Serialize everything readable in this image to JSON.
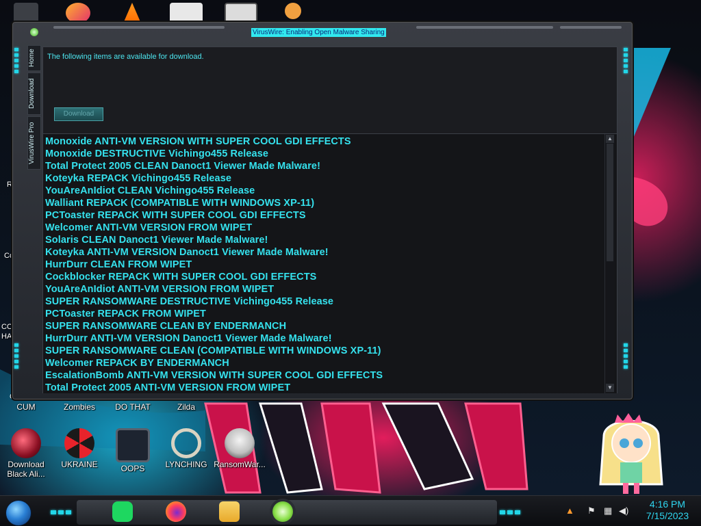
{
  "window": {
    "title": "VirusWire: Enabling Open Malware Sharing",
    "tabs": [
      "Home",
      "Download",
      "VirusWire Pro"
    ],
    "intro_text": "The following items are available for download.",
    "download_button": "Download",
    "items": [
      "Monoxide ANTI-VM VERSION WITH SUPER COOL GDI EFFECTS",
      "Monoxide DESTRUCTIVE Vichingo455 Release",
      "Total Protect 2005 CLEAN Danoct1 Viewer Made Malware!",
      "Koteyka REPACK Vichingo455 Release",
      "YouAreAnIdiot CLEAN Vichingo455 Release",
      "Walliant REPACK (COMPATIBLE WITH WINDOWS XP-11)",
      "PCToaster REPACK WITH SUPER COOL GDI EFFECTS",
      "Welcomer ANTI-VM VERSION FROM WIPET",
      "Solaris CLEAN Danoct1 Viewer Made Malware!",
      "Koteyka ANTI-VM VERSION Danoct1 Viewer Made Malware!",
      "HurrDurr CLEAN FROM WIPET",
      "Cockblocker REPACK WITH SUPER COOL GDI EFFECTS",
      "YouAreAnIdiot ANTI-VM VERSION FROM WIPET",
      "SUPER RANSOMWARE DESTRUCTIVE Vichingo455 Release",
      "PCToaster REPACK FROM WIPET",
      "SUPER RANSOMWARE CLEAN BY ENDERMANCH",
      "HurrDurr ANTI-VM VERSION Danoct1 Viewer Made Malware!",
      "SUPER RANSOMWARE CLEAN (COMPATIBLE WITH WINDOWS XP-11)",
      "Welcomer REPACK BY ENDERMANCH",
      "EscalationBomb ANTI-VM VERSION WITH SUPER COOL GDI EFFECTS",
      "Total Protect 2005 ANTI-VM VERSION FROM WIPET"
    ]
  },
  "desktop": {
    "row1": [
      "CUM",
      "Zombies",
      "DO THAT",
      "Zilda"
    ],
    "row2": [
      {
        "label": "Download Black Ali...",
        "icon": "red-orb-icon"
      },
      {
        "label": "UKRAINE",
        "icon": "radiation-icon"
      },
      {
        "label": "OOPS",
        "icon": "monitor-icon"
      },
      {
        "label": "LYNCHING",
        "icon": "noose-icon"
      },
      {
        "label": "RansomWar...",
        "icon": "skull-icon"
      }
    ],
    "left_partial": [
      "Re",
      "Co",
      "CON",
      "HAT",
      "C"
    ]
  },
  "taskbar": {
    "apps": [
      "notes-app-icon",
      "firefox-icon",
      "file-explorer-icon",
      "virus-app-icon"
    ],
    "time": "4:16 PM",
    "date": "7/15/2023"
  },
  "colors": {
    "accent": "#35e2ee",
    "list_bg": "#141518",
    "title_highlight": "#31e8ef"
  }
}
